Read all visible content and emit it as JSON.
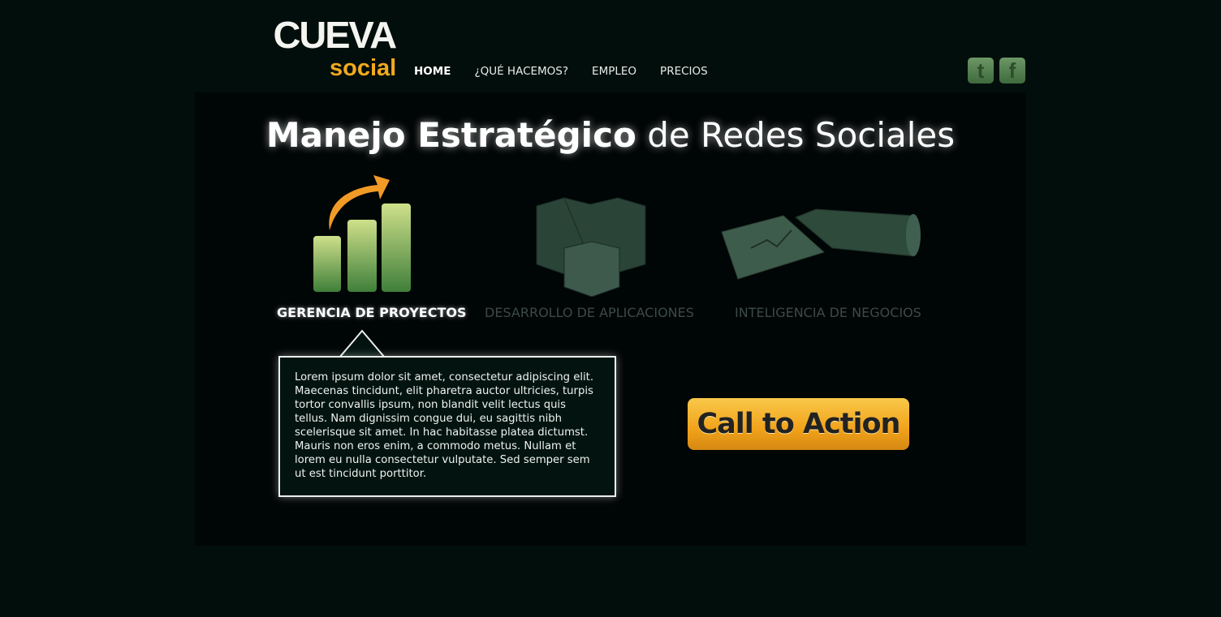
{
  "logo": {
    "line1": "CUEVA",
    "line2": "social"
  },
  "nav": [
    {
      "label": "HOME"
    },
    {
      "label": "¿QUÉ HACEMOS?"
    },
    {
      "label": "EMPLEO"
    },
    {
      "label": "PRECIOS"
    }
  ],
  "social": {
    "twitter": "t",
    "facebook": "f"
  },
  "hero": {
    "title_bold": "Manejo Estratégico",
    "title_light": "de Redes Sociales"
  },
  "features": [
    {
      "label": "GERENCIA DE PROYECTOS"
    },
    {
      "label": "DESARROLLO DE APLICACIONES"
    },
    {
      "label": "INTELIGENCIA DE NEGOCIOS"
    }
  ],
  "description": "Lorem ipsum dolor sit amet, consectetur adipiscing elit. Maecenas tincidunt, elit pharetra auctor ultricies, turpis tortor convallis ipsum, non blandit velit lectus quis tellus. Nam dignissim congue dui, eu sagittis nibh scelerisque sit amet. In hac habitasse platea dictumst. Mauris non eros enim, a commodo metus. Nullam et lorem eu nulla consectetur vulputate. Sed semper sem ut est tincidunt porttitor.",
  "cta": "Call to Action",
  "colors": {
    "accent": "#f2a91e",
    "bg": "#020e0b",
    "panel": "#000505"
  }
}
